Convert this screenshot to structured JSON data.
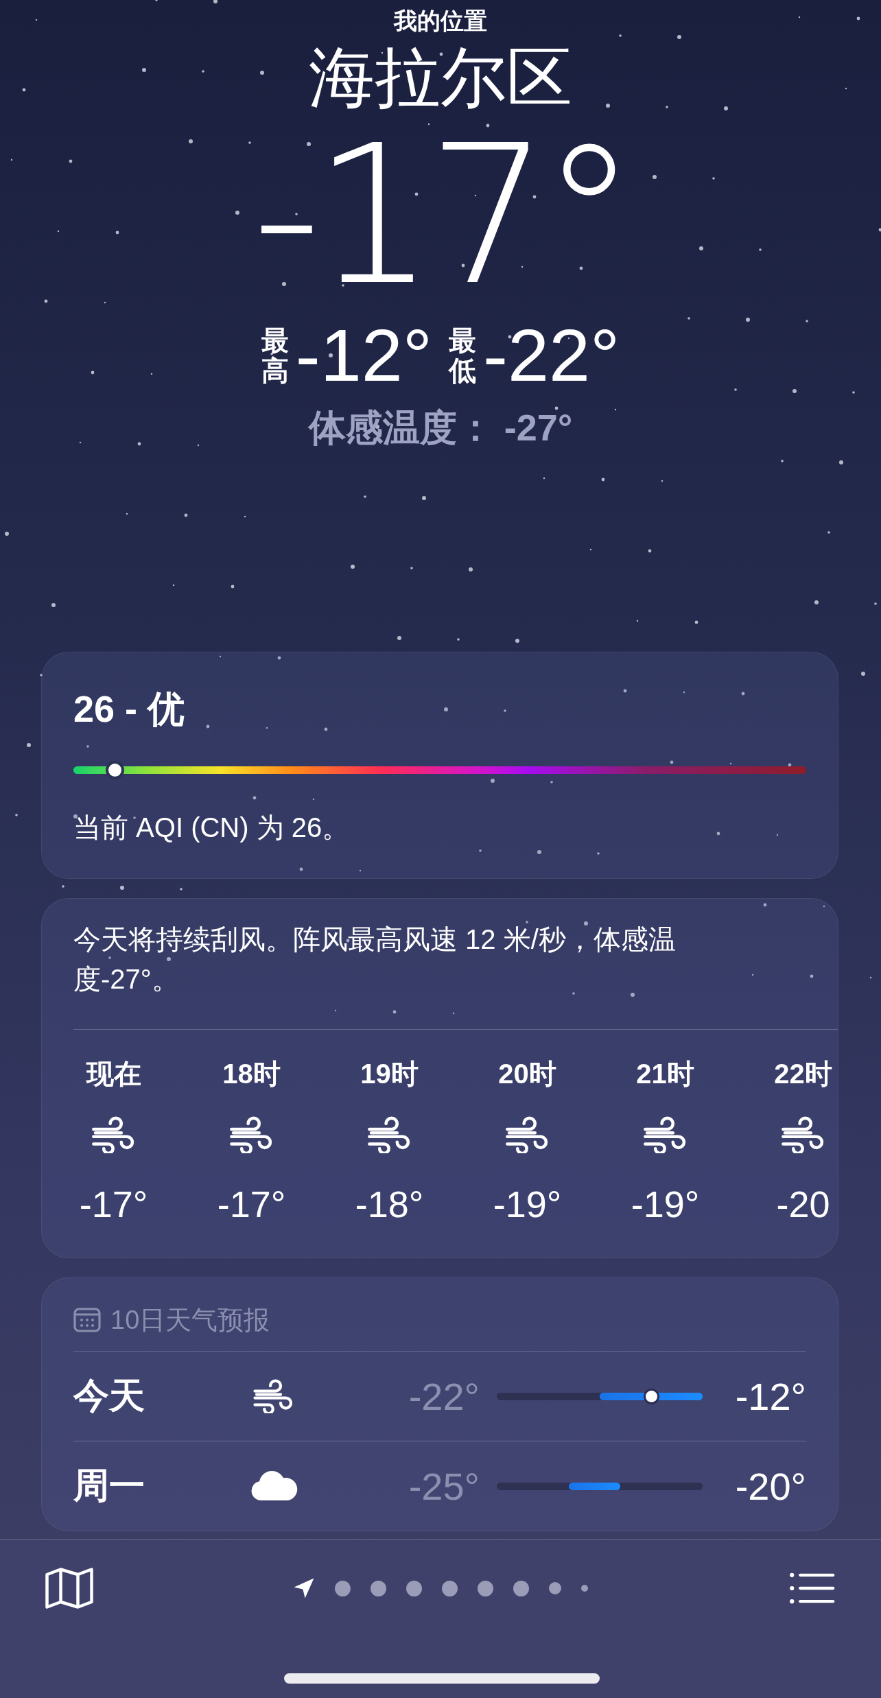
{
  "header": {
    "location_label": "我的位置",
    "city": "海拉尔区",
    "temperature": "-17°",
    "high_label": "最高",
    "high": "-12°",
    "low_label": "最低",
    "low": "-22°",
    "feels_like": "体感温度： -27°"
  },
  "aqi": {
    "title": "26 - 优",
    "level": 0.056,
    "description": "当前 AQI (CN) 为 26。"
  },
  "hourly": {
    "summary": "今天将持续刮风。阵风最高风速 12 米/秒，体感温度-27°。",
    "hours": [
      {
        "time": "现在",
        "kind": "wind",
        "temp": "-17°"
      },
      {
        "time": "18时",
        "kind": "wind",
        "temp": "-17°"
      },
      {
        "time": "19时",
        "kind": "wind",
        "temp": "-18°"
      },
      {
        "time": "20时",
        "kind": "wind",
        "temp": "-19°"
      },
      {
        "time": "21时",
        "kind": "wind",
        "temp": "-19°"
      },
      {
        "time": "22时",
        "kind": "wind",
        "temp": "-20"
      }
    ]
  },
  "daily": {
    "title": "10日天气预报",
    "days": [
      {
        "day": "今天",
        "kind": "wind",
        "low": "-22°",
        "high": "-12°",
        "level": 0.75
      },
      {
        "day": "周一",
        "kind": "cloud",
        "low": "-25°",
        "high": "-20°"
      }
    ]
  },
  "pages": [
    {
      "kind": "location",
      "selected": true
    },
    {
      "kind": "dot",
      "selected": false
    },
    {
      "kind": "dot",
      "selected": false
    },
    {
      "kind": "dot",
      "selected": false
    },
    {
      "kind": "dot",
      "selected": false
    },
    {
      "kind": "dot",
      "selected": false
    },
    {
      "kind": "dot",
      "selected": false
    },
    {
      "kind": "small",
      "selected": false
    },
    {
      "kind": "tiny",
      "selected": false
    }
  ]
}
